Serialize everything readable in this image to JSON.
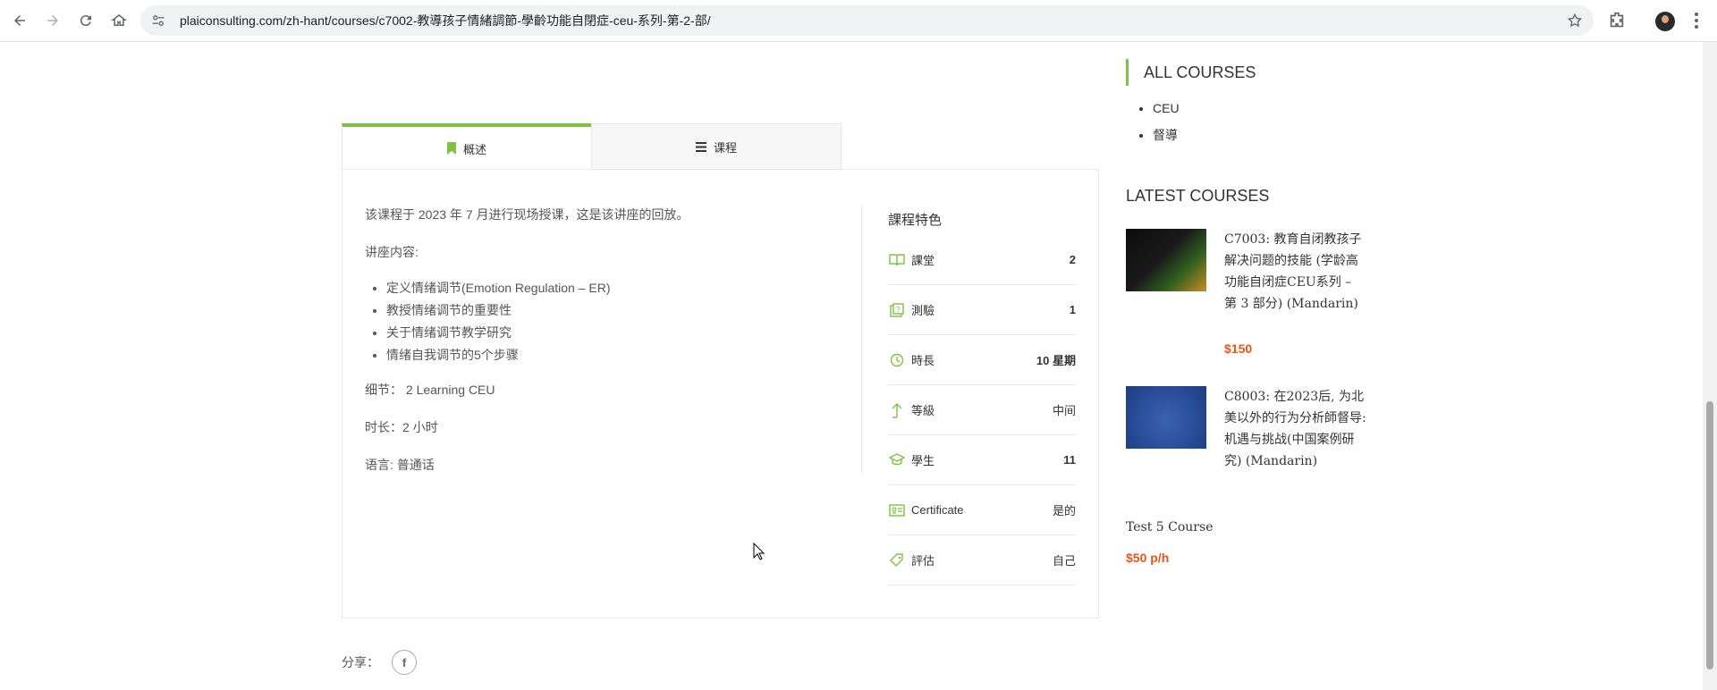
{
  "browser": {
    "url": "plaiconsulting.com/zh-hant/courses/c7002-教導孩子情緒調節-學齡功能自閉症-ceu-系列-第-2-部/"
  },
  "tabs": [
    {
      "label": "概述",
      "icon": "bookmark-icon"
    },
    {
      "label": "课程",
      "icon": "list-icon"
    }
  ],
  "overview": {
    "intro": "该课程于 2023 年 7 月进行现场授课，这是该讲座的回放。",
    "content_label": "讲座内容:",
    "topics": [
      "定义情绪调节(Emotion Regulation – ER)",
      "教授情绪调节的重要性",
      "关于情绪调节教学研究",
      "情绪自我调节的5个步骤"
    ],
    "details": "细节： 2 Learning CEU",
    "duration": "时长：2 小时",
    "language": "语言: 普通话"
  },
  "features": {
    "title": "課程特色",
    "rows": [
      {
        "icon": "book-icon",
        "label": "課堂",
        "value": "2"
      },
      {
        "icon": "quiz-icon",
        "label": "測驗",
        "value": "1"
      },
      {
        "icon": "clock-icon",
        "label": "時長",
        "value": "10 星期"
      },
      {
        "icon": "level-icon",
        "label": "等級",
        "value": "中间"
      },
      {
        "icon": "graduation-cap-icon",
        "label": "學生",
        "value": "11"
      },
      {
        "icon": "certificate-icon",
        "label": "Certificate",
        "value": "是的"
      },
      {
        "icon": "tag-icon",
        "label": "評估",
        "value": "自己"
      }
    ]
  },
  "share": {
    "label": "分享：",
    "facebook_glyph": "f"
  },
  "sidebar": {
    "all_courses_title": "ALL COURSES",
    "categories": [
      "CEU",
      "督導"
    ],
    "latest_title": "LATEST COURSES",
    "courses": [
      {
        "title": "C7003: 教育自闭教孩子解决问题的技能 (学龄高功能自闭症CEU系列 – 第 3 部分) (Mandarin)",
        "price": "$150"
      },
      {
        "title": "C8003: 在2023后, 为北美以外的行为分析師督导: 机遇与挑战(中国案例研究) (Mandarin)",
        "price": ""
      },
      {
        "title": "Test 5 Course",
        "price": "$50 p/h"
      }
    ]
  },
  "colors": {
    "accent": "#7dc242",
    "price": "#e8541a"
  }
}
